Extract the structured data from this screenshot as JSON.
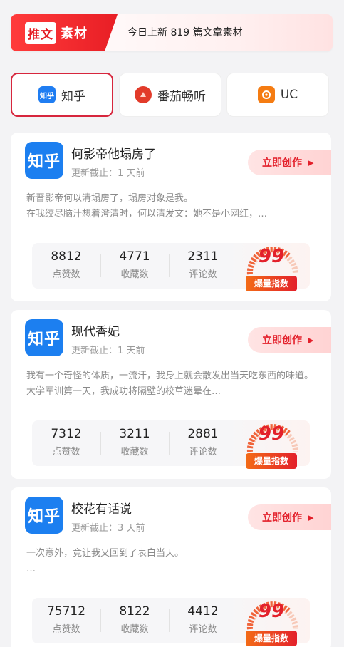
{
  "banner": {
    "badge_a": "推文",
    "badge_b": "素材",
    "text": "今日上新 819 篇文章素材"
  },
  "tabs": [
    {
      "label": "知乎",
      "icon": "zhihu-icon",
      "icon_text": "知乎"
    },
    {
      "label": "番茄畅听",
      "icon": "fanqie-icon",
      "icon_text": ""
    },
    {
      "label": "UC",
      "icon": "uc-icon",
      "icon_text": ""
    }
  ],
  "cards": [
    {
      "app_logo": "知乎",
      "title": "何影帝他塌房了",
      "updated": "更新截止：1 天前",
      "create_label": "立即创作",
      "summary": "新晋影帝何以清塌房了，塌房对象是我。\n在我绞尽脑汁想着澄清时，何以清发文：她不是小网红，…",
      "likes": "8812",
      "likes_label": "点赞数",
      "favorites": "4771",
      "favorites_label": "收藏数",
      "comments": "2311",
      "comments_label": "评论数",
      "score": "99",
      "score_label": "爆量指数"
    },
    {
      "app_logo": "知乎",
      "title": "现代香妃",
      "updated": "更新截止：1 天前",
      "create_label": "立即创作",
      "summary": "我有一个奇怪的体质，一流汗，我身上就会散发出当天吃东西的味道。大学军训第一天，我成功将隔壁的校草迷晕在…",
      "likes": "7312",
      "likes_label": "点赞数",
      "favorites": "3211",
      "favorites_label": "收藏数",
      "comments": "2881",
      "comments_label": "评论数",
      "score": "99",
      "score_label": "爆量指数"
    },
    {
      "app_logo": "知乎",
      "title": "校花有话说",
      "updated": "更新截止：3 天前",
      "create_label": "立即创作",
      "summary": "一次意外，竟让我又回到了表白当天。\n…",
      "likes": "75712",
      "likes_label": "点赞数",
      "favorites": "8122",
      "favorites_label": "收藏数",
      "comments": "4412",
      "comments_label": "评论数",
      "score": "99",
      "score_label": "爆量指数"
    }
  ],
  "colors": {
    "accent": "#e3202b",
    "zhihu_blue": "#1c7ff0",
    "orange": "#f36b16"
  }
}
